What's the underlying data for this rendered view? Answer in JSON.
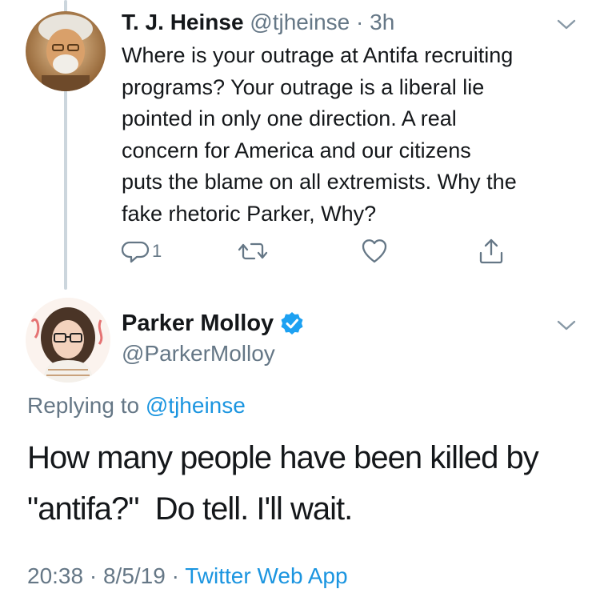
{
  "tweet1": {
    "display_name": "T. J. Heinse",
    "handle": "@tjheinse",
    "separator": "·",
    "time_ago": "3h",
    "text_lines": [
      "Where is your outrage at Antifa recruiting",
      "programs? Your outrage is a liberal lie",
      "pointed in only one direction. A real",
      "concern for America and our citizens",
      "puts the blame on all extremists. Why the",
      "fake rhetoric Parker, Why?"
    ],
    "actions": {
      "reply_icon": "reply-icon",
      "reply_count": "1",
      "retweet_icon": "retweet-icon",
      "like_icon": "heart-icon",
      "share_icon": "share-icon"
    }
  },
  "tweet2": {
    "display_name": "Parker Molloy",
    "handle": "@ParkerMolloy",
    "verified_icon": "verified-badge-icon",
    "replying_prefix": "Replying to",
    "replying_to": "@tjheinse",
    "text_lines": [
      "How many people have been killed by",
      "\"antifa?\"  Do tell. I'll wait."
    ],
    "time": "20:38",
    "separator": "·",
    "date": "8/5/19",
    "separator2": "·",
    "source": "Twitter Web App"
  },
  "colors": {
    "text_primary": "#14171a",
    "text_secondary": "#657786",
    "link": "#1b95e0",
    "verified": "#1da1f2",
    "thread_line": "#ccd6dd"
  }
}
